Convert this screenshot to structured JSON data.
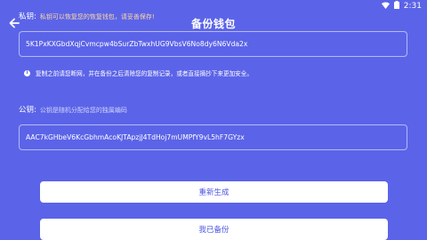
{
  "status_bar": {
    "time": "2:31",
    "wifi_icon": "wifi-icon",
    "battery_icon": "battery-icon"
  },
  "header": {
    "title": "备份钱包",
    "back_icon": "back-arrow-icon"
  },
  "private_key": {
    "label": "私钥:",
    "hint": "私钥可以恢复您的恢复钱包，请妥善保存!",
    "value": "5K1PxKXGbdXqjCvmcpw4bSurZbTwxhUG9VbsV6No8dy6N6Vda2x"
  },
  "notice": {
    "icon": "info-icon",
    "text": "复制之前请您断网，并在备份之后清除您的复制记录，或者直接摘抄下来更加安全。"
  },
  "public_key": {
    "label": "公钥:",
    "hint": "公钥是随机分配给您的独属编码",
    "value": "AAC7kGHbeV6KcGbhmAcoKJTApzjJ4TdHoj7mUMPfY9vL5hF7GYzx"
  },
  "buttons": {
    "regenerate": "重新生成",
    "backed_up": "我已备份"
  },
  "colors": {
    "background": "#5b64e8",
    "warning_text": "#ffd7a3",
    "button_text": "#4c55e0"
  }
}
